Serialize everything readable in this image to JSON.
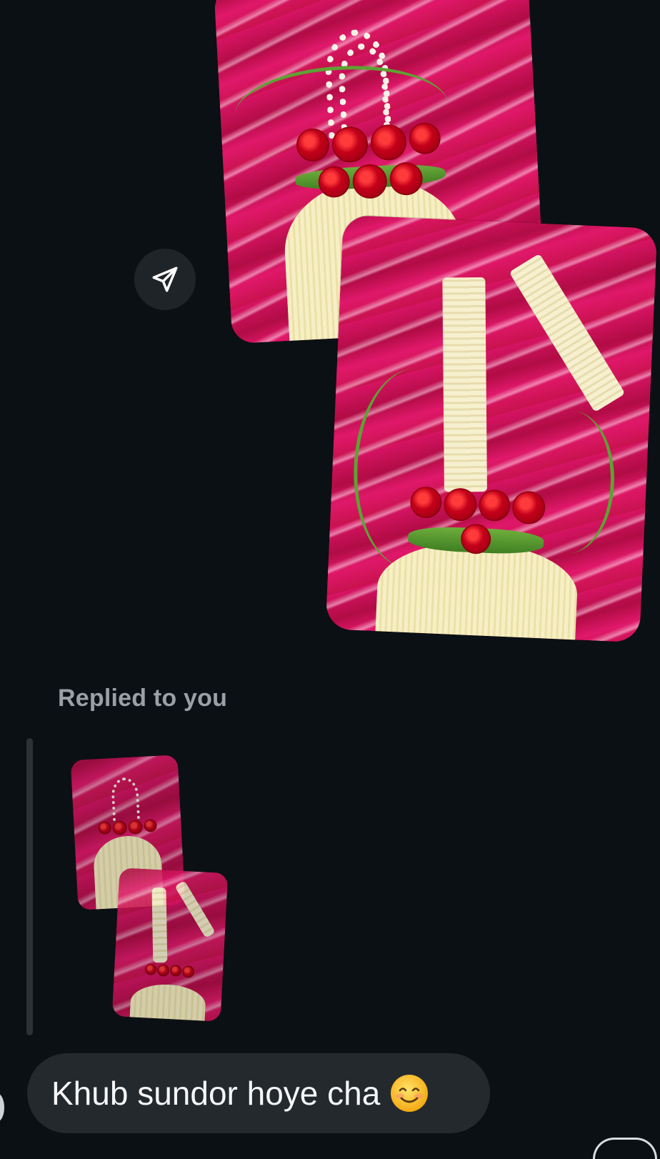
{
  "thread": {
    "shared_message": {
      "photo_count": 2,
      "photo_subject": "crocheted potli bag with red roses on pink tie-dye fabric"
    },
    "share_button": {
      "icon": "send-icon"
    },
    "reply": {
      "label": "Replied to you",
      "quoted_photo_count": 2
    },
    "message": {
      "text": "Khub sundor hoye cha",
      "emoji": "smiling-face-emoji"
    }
  },
  "colors": {
    "background": "#0b1014",
    "bubble": "#24292e",
    "share_button": "#1f2428",
    "muted_label": "#9aa0a6",
    "reply_bar": "#2c3136"
  }
}
